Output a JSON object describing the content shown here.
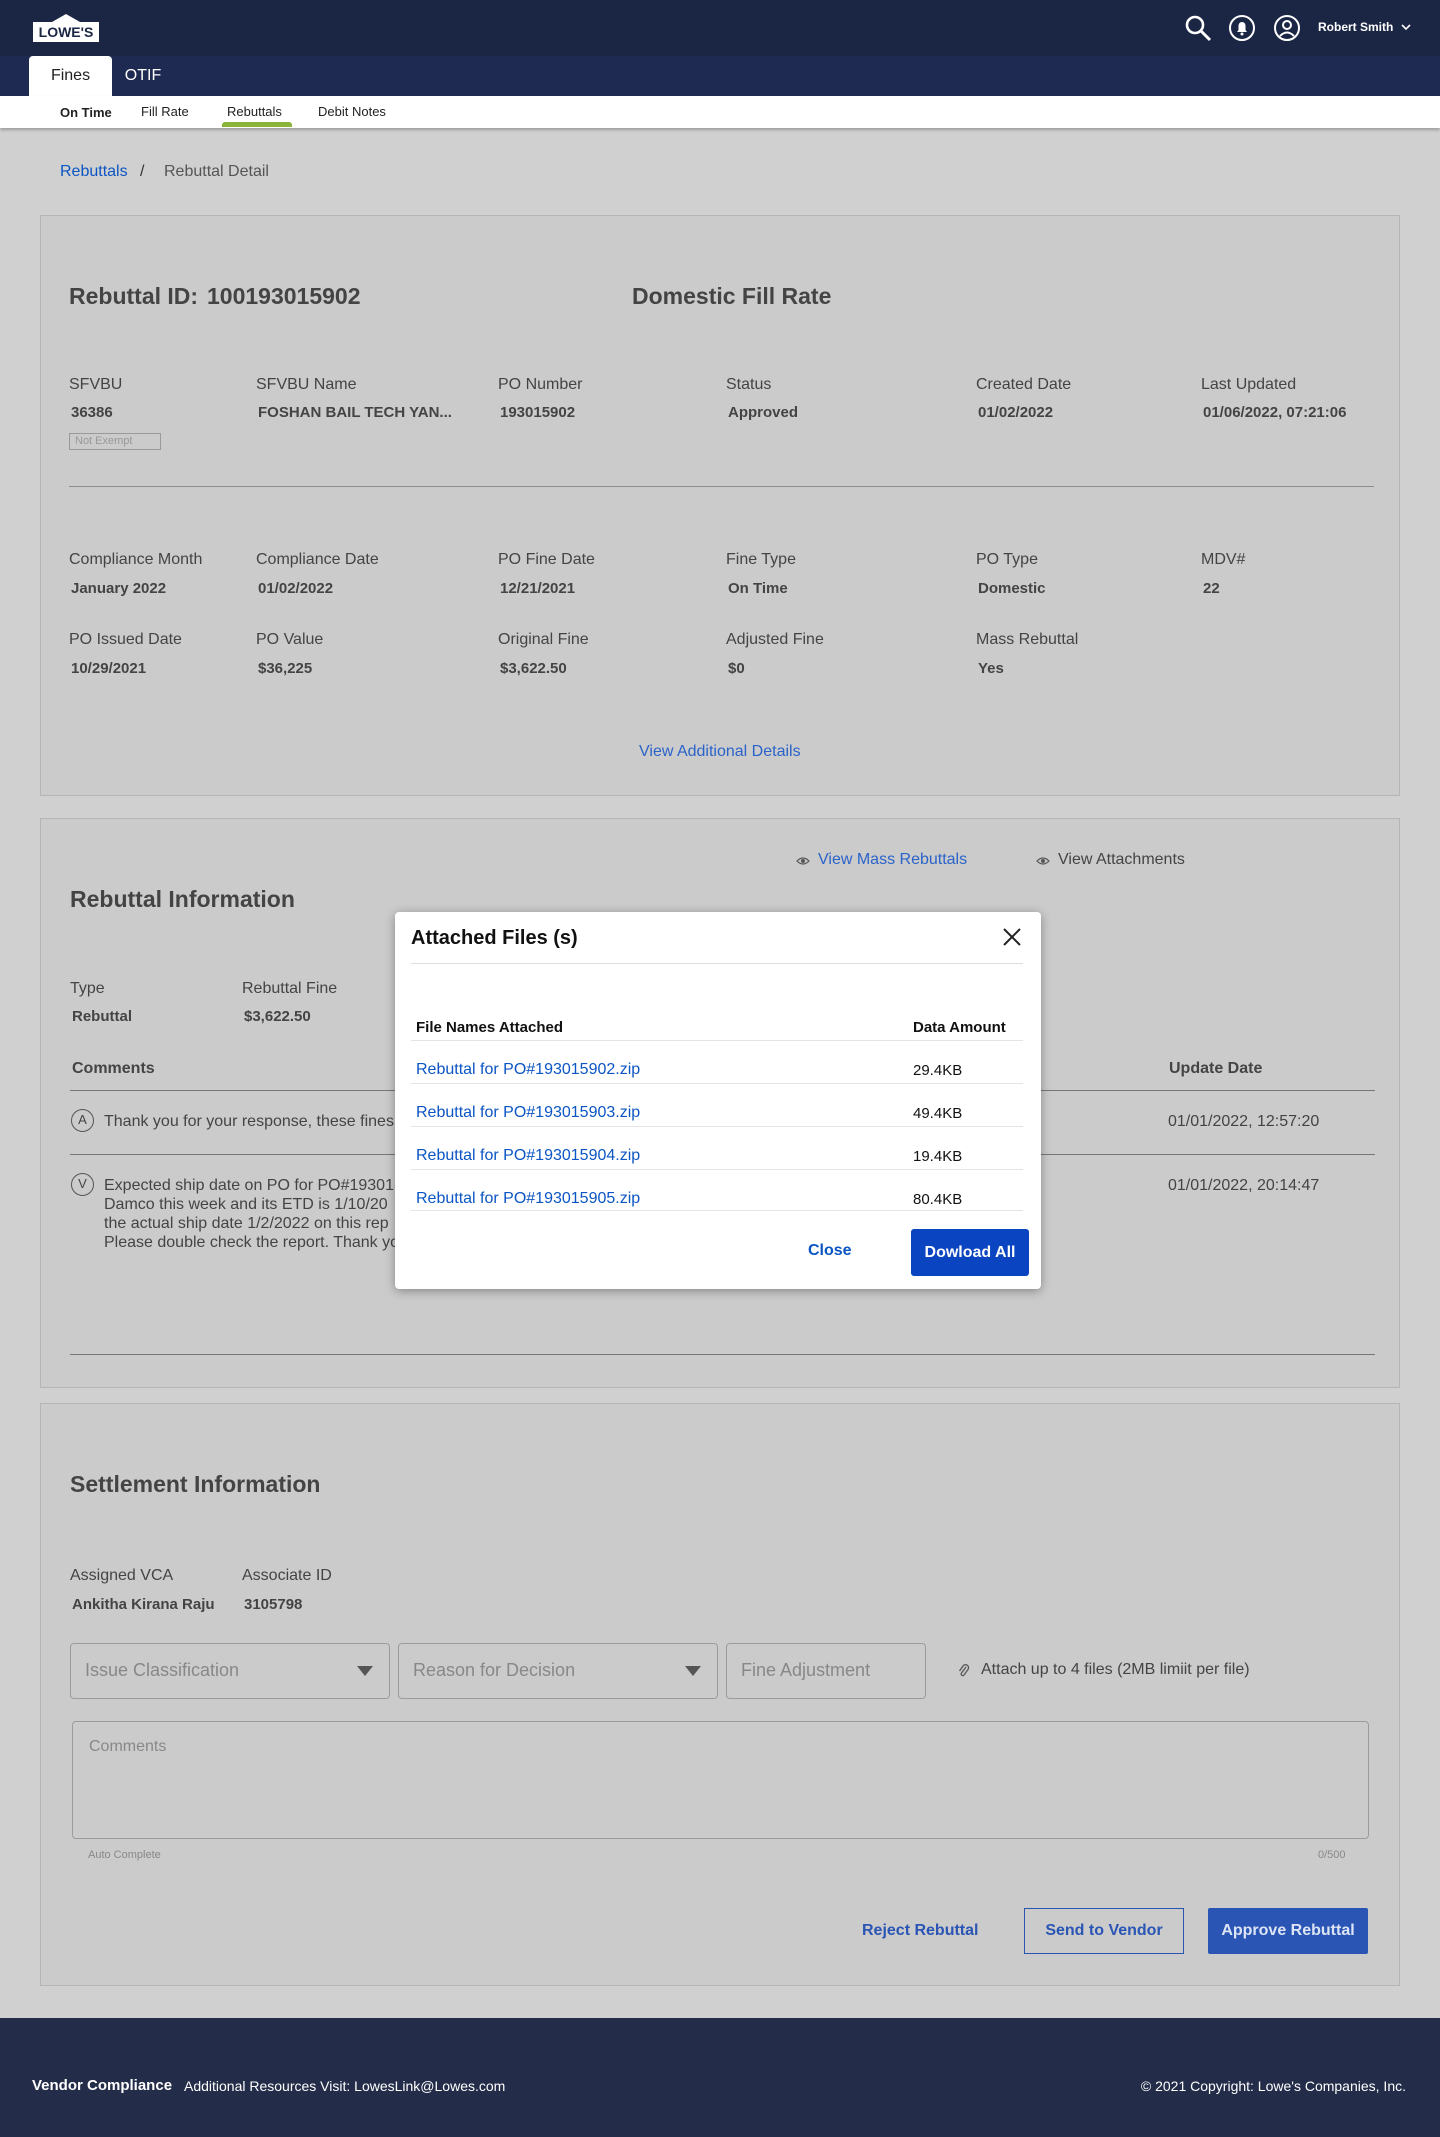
{
  "header": {
    "logo_text": "LOWE'S",
    "user_name": "Robert Smith",
    "icons": [
      "search-icon",
      "notification-bell-icon",
      "user-account-icon",
      "chevron-down-icon"
    ]
  },
  "tabs": [
    {
      "label": "Fines",
      "active": true
    },
    {
      "label": "OTIF",
      "active": false
    }
  ],
  "subnav": [
    {
      "label": "On Time"
    },
    {
      "label": "Fill Rate"
    },
    {
      "label": "Rebuttals",
      "active": true
    },
    {
      "label": "Debit Notes"
    }
  ],
  "breadcrumb": {
    "link": "Rebuttals",
    "separator": "/",
    "current": "Rebuttal Detail"
  },
  "summary": {
    "rebuttal_id_label": "Rebuttal ID:",
    "rebuttal_id": "100193015902",
    "type_title": "Domestic Fill Rate",
    "row1": [
      {
        "label": "SFVBU",
        "value": "36386"
      },
      {
        "label": "SFVBU Name",
        "value": "FOSHAN BAIL TECH YAN..."
      },
      {
        "label": "PO Number",
        "value": "193015902"
      },
      {
        "label": "Status",
        "value": "Approved"
      },
      {
        "label": "Created Date",
        "value": "01/02/2022"
      },
      {
        "label": "Last Updated",
        "value": "01/06/2022, 07:21:06"
      }
    ],
    "exempt_tag": "Not Exempt",
    "row2": [
      {
        "label": "Compliance Month",
        "value": "January 2022"
      },
      {
        "label": "Compliance Date",
        "value": "01/02/2022"
      },
      {
        "label": "PO Fine Date",
        "value": "12/21/2021"
      },
      {
        "label": "Fine Type",
        "value": "On Time"
      },
      {
        "label": "PO Type",
        "value": "Domestic"
      },
      {
        "label": "MDV#",
        "value": "22"
      }
    ],
    "row3": [
      {
        "label": "PO Issued Date",
        "value": "10/29/2021"
      },
      {
        "label": "PO Value",
        "value": "$36,225"
      },
      {
        "label": "Original Fine",
        "value": "$3,622.50"
      },
      {
        "label": "Adjusted Fine",
        "value": "$0"
      },
      {
        "label": "Mass Rebuttal",
        "value": "Yes"
      }
    ],
    "view_details_link": "View Additional Details"
  },
  "rebuttal_info": {
    "title": "Rebuttal Information",
    "view_mass_link": "View Mass Rebuttals",
    "view_attachments_link": "View Attachments",
    "fields": [
      {
        "label": "Type",
        "value": "Rebuttal"
      },
      {
        "label": "Rebuttal Fine",
        "value": "$3,622.50"
      }
    ],
    "comments_header": "Comments",
    "update_date_header": "Update Date",
    "comments": [
      {
        "avatar": "A",
        "text": [
          "Thank you for your response, these fines"
        ],
        "date": "01/01/2022, 12:57:20"
      },
      {
        "avatar": "V",
        "text": [
          "Expected ship date on PO for PO#193015",
          "Damco this week and its ETD  is 1/10/20",
          "the actual ship date 1/2/2022 on this rep",
          "Please double check the report.  Thank yo"
        ],
        "date": "01/01/2022, 20:14:47"
      }
    ]
  },
  "settlement": {
    "title": "Settlement Information",
    "fields": [
      {
        "label": "Assigned VCA",
        "value": "Ankitha Kirana Raju"
      },
      {
        "label": "Associate ID",
        "value": "3105798"
      }
    ],
    "issue_placeholder": "Issue Classification",
    "reason_placeholder": "Reason for Decision",
    "fine_adj_placeholder": "Fine Adjustment",
    "attach_text": "Attach up to 4 files (2MB limiit per file)",
    "comments_placeholder": "Comments",
    "auto_complete": "Auto Complete",
    "char_count": "0/500",
    "reject_label": "Reject Rebuttal",
    "send_label": "Send to Vendor",
    "approve_label": "Approve Rebuttal"
  },
  "modal": {
    "title": "Attached Files (s)",
    "col_file": "File Names Attached",
    "col_size": "Data Amount",
    "files": [
      {
        "name": "Rebuttal for PO#193015902.zip",
        "size": "29.4KB"
      },
      {
        "name": "Rebuttal for PO#193015903.zip",
        "size": "49.4KB"
      },
      {
        "name": "Rebuttal for PO#193015904.zip",
        "size": "19.4KB"
      },
      {
        "name": "Rebuttal for PO#193015905.zip",
        "size": "80.4KB"
      }
    ],
    "close_label": "Close",
    "download_label": "Dowload All"
  },
  "footer": {
    "brand": "Vendor Compliance",
    "resources": "Additional Resources Visit: LowesLink@Lowes.com",
    "copyright": "© 2021 Copyright: Lowe's Companies, Inc."
  }
}
